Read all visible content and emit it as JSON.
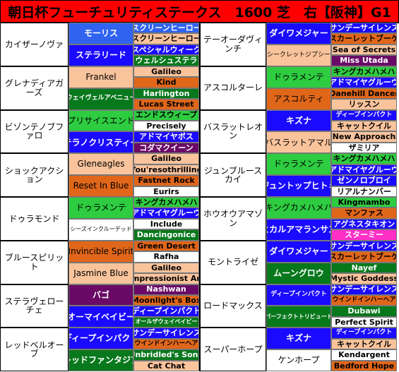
{
  "title": "朝日杯フューチュリティステークス　1600 芝　右【阪神】G1",
  "colors": {
    "title_bg": "#ff0000",
    "blue": "#1a0aff",
    "light_blue": "#2f63f0",
    "peach": "#f9c39c",
    "orange": "#e0661a",
    "dark_green": "#08781c",
    "green": "#2ecc40",
    "white": "#ffffff",
    "purple": "#6a0a66",
    "pink": "#ff2fc8"
  },
  "left": [
    {
      "horse": "カイザーノヴァ",
      "sire": {
        "name": "モーリス",
        "color": "lblue"
      },
      "dam": {
        "name": "ステラリード",
        "color": "blue"
      },
      "gp": [
        {
          "name": "スクリーンヒーロー",
          "color": "lblue"
        },
        {
          "name": "スクリーンヒーロー",
          "color": "peach"
        },
        {
          "name": "スペシャルウィーク",
          "color": "blue"
        },
        {
          "name": "ウェルシュステラ",
          "color": "dgreen"
        }
      ]
    },
    {
      "horse": "グレナディアガーズ",
      "sire": {
        "name": "Frankel",
        "color": "peach"
      },
      "dam": {
        "name": "ウェイヴェルアベニュー",
        "color": "dgreen",
        "size": "sm"
      },
      "gp": [
        {
          "name": "Galileo",
          "color": "peach"
        },
        {
          "name": "Kind",
          "color": "orange"
        },
        {
          "name": "Harlington",
          "color": "dgreen"
        },
        {
          "name": "Lucas Street",
          "color": "orange"
        }
      ]
    },
    {
      "horse": "ビゾンテノブファロ",
      "sire": {
        "name": "プリサイスエンド",
        "color": "green"
      },
      "dam": {
        "name": "テラノクリスティー",
        "color": "blue"
      },
      "gp": [
        {
          "name": "エンドスウィープ",
          "color": "green"
        },
        {
          "name": "Precisely",
          "color": "white"
        },
        {
          "name": "アドマイヤボス",
          "color": "blue"
        },
        {
          "name": "コダマクイーン",
          "color": "purple"
        }
      ]
    },
    {
      "horse": "ショックアクション",
      "sire": {
        "name": "Gleneagles",
        "color": "peach"
      },
      "dam": {
        "name": "Reset In Blue",
        "color": "orange"
      },
      "gp": [
        {
          "name": "Galileo",
          "color": "peach"
        },
        {
          "name": "You'resothrilling",
          "color": "peach"
        },
        {
          "name": "Fastnet Rock",
          "color": "orange"
        },
        {
          "name": "Eurirs",
          "color": "white"
        }
      ]
    },
    {
      "horse": "ドゥラモンド",
      "sire": {
        "name": "ドゥラメンテ",
        "color": "green"
      },
      "dam": {
        "name": "シーズインクルーデッド",
        "color": "white",
        "size": "xs"
      },
      "gp": [
        {
          "name": "キングカメハメハ",
          "color": "green"
        },
        {
          "name": "アドマイヤグルーヴ",
          "color": "blue"
        },
        {
          "name": "Include",
          "color": "white"
        },
        {
          "name": "Dancingonice",
          "color": "dgreen"
        }
      ]
    },
    {
      "horse": "ブルースピリット",
      "sire": {
        "name": "Invincible Spirit",
        "color": "orange"
      },
      "dam": {
        "name": "Jasmine Blue",
        "color": "peach"
      },
      "gp": [
        {
          "name": "Green Desert",
          "color": "orange"
        },
        {
          "name": "Rafha",
          "color": "white"
        },
        {
          "name": "Galileo",
          "color": "peach"
        },
        {
          "name": "Impressionist Art",
          "color": "peach"
        }
      ]
    },
    {
      "horse": "ステラヴェロー チェ",
      "sire": {
        "name": "バゴ",
        "color": "purple"
      },
      "dam": {
        "name": "オーマイベイビー",
        "color": "blue"
      },
      "gp": [
        {
          "name": "Nashwan",
          "color": "purple"
        },
        {
          "name": "Moonlight's Box",
          "color": "orange"
        },
        {
          "name": "ディープインパクト",
          "color": "blue"
        },
        {
          "name": "オールザウェイベイビー",
          "color": "dgreen",
          "size": "xs"
        }
      ]
    },
    {
      "horse": "レッドベルオーブ",
      "sire": {
        "name": "ディープインパクト",
        "color": "blue"
      },
      "dam": {
        "name": "レッドファンタジア",
        "color": "dgreen"
      },
      "gp": [
        {
          "name": "サンデーサイレンス",
          "color": "blue"
        },
        {
          "name": "ウインドインハーヘア",
          "color": "orange",
          "size": "sm"
        },
        {
          "name": "Unbridled's Song",
          "color": "dgreen"
        },
        {
          "name": "Cat Chat",
          "color": "peach"
        }
      ]
    }
  ],
  "right": [
    {
      "horse": "テーオーダヴィンチ",
      "sire": {
        "name": "ダイワメジャー",
        "color": "blue"
      },
      "dam": {
        "name": "シークレットジプシー",
        "color": "peach",
        "size": "sm"
      },
      "gp": [
        {
          "name": "サンデーサイレンス",
          "color": "blue"
        },
        {
          "name": "スカーレットブーケ",
          "color": "orange"
        },
        {
          "name": "Sea of Secrets",
          "color": "peach"
        },
        {
          "name": "Miss Utada",
          "color": "purple"
        }
      ]
    },
    {
      "horse": "アスコルターレ",
      "sire": {
        "name": "ドゥラメンテ",
        "color": "green"
      },
      "dam": {
        "name": "アスコルティ",
        "color": "orange"
      },
      "gp": [
        {
          "name": "キングカメハメハ",
          "color": "green"
        },
        {
          "name": "アドマイヤグルーヴ",
          "color": "blue"
        },
        {
          "name": "Danehill Dancer",
          "color": "orange"
        },
        {
          "name": "リッスン",
          "color": "peach"
        }
      ]
    },
    {
      "horse": "バスラットレオン",
      "sire": {
        "name": "キズナ",
        "color": "blue"
      },
      "dam": {
        "name": "バスラットアマル",
        "color": "peach"
      },
      "gp": [
        {
          "name": "ディープインパクト",
          "color": "blue",
          "size": "sm"
        },
        {
          "name": "キャットクイル",
          "color": "peach"
        },
        {
          "name": "New Approach",
          "color": "peach"
        },
        {
          "name": "ザミリア",
          "color": "white"
        }
      ]
    },
    {
      "horse": "ジュンブルースカイ",
      "sire": {
        "name": "ドゥラメンテ",
        "color": "green"
      },
      "dam": {
        "name": "ジュントップヒトミ",
        "color": "blue"
      },
      "gp": [
        {
          "name": "キングカメハメハ",
          "color": "green"
        },
        {
          "name": "アドマイヤグルーヴ",
          "color": "blue"
        },
        {
          "name": "ゼンノロブロイ",
          "color": "blue"
        },
        {
          "name": "リアルナンバー",
          "color": "white"
        }
      ]
    },
    {
      "horse": "ホウオウアマゾン",
      "sire": {
        "name": "キングカメハメハ",
        "color": "green"
      },
      "dam": {
        "name": "ヒカルアマランサス",
        "color": "blue"
      },
      "gp": [
        {
          "name": "Kingmambo",
          "color": "green"
        },
        {
          "name": "マンファス",
          "color": "orange"
        },
        {
          "name": "アグネスタキオン",
          "color": "blue"
        },
        {
          "name": "スターミー",
          "color": "pink"
        }
      ]
    },
    {
      "horse": "モントライゼ",
      "sire": {
        "name": "ダイワメジャー",
        "color": "blue"
      },
      "dam": {
        "name": "ムーングロウ",
        "color": "dgreen"
      },
      "gp": [
        {
          "name": "サンデーサイレンス",
          "color": "blue"
        },
        {
          "name": "スカーレットブーケ",
          "color": "orange"
        },
        {
          "name": "Nayef",
          "color": "dgreen"
        },
        {
          "name": "Mystic Goddess",
          "color": "peach"
        }
      ]
    },
    {
      "horse": "ロードマックス",
      "sire": {
        "name": "ディープインパクト",
        "color": "blue",
        "size": "sm"
      },
      "dam": {
        "name": "パーフェクトトリビュート",
        "color": "dgreen",
        "size": "xs"
      },
      "gp": [
        {
          "name": "サンデーサイレンス",
          "color": "blue"
        },
        {
          "name": "ウインドインハーヘア",
          "color": "orange",
          "size": "sm"
        },
        {
          "name": "Dubawi",
          "color": "dgreen"
        },
        {
          "name": "Perfect Spirit",
          "color": "white"
        }
      ]
    },
    {
      "horse": "スーパーホープ",
      "sire": {
        "name": "キズナ",
        "color": "blue"
      },
      "dam": {
        "name": "ケンホープ",
        "color": "white"
      },
      "gp": [
        {
          "name": "ディープインパクト",
          "color": "blue",
          "size": "sm"
        },
        {
          "name": "キャットクイル",
          "color": "peach"
        },
        {
          "name": "Kendargent",
          "color": "white"
        },
        {
          "name": "Bedford Hope",
          "color": "orange"
        }
      ]
    }
  ]
}
